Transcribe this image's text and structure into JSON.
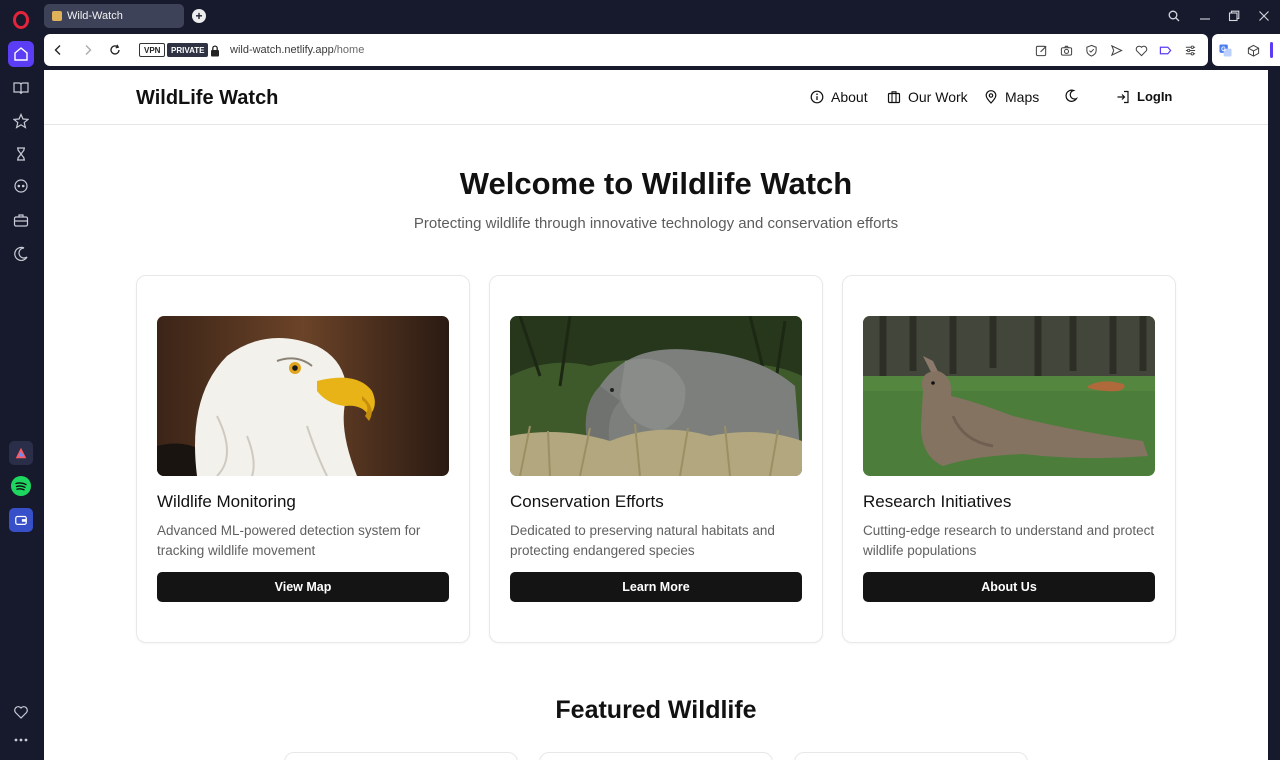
{
  "browser": {
    "tab_title": "Wild-Watch",
    "new_tab": "+",
    "badges": {
      "vpn": "VPN",
      "private": "PRIVATE"
    },
    "url_host": "wild-watch.netlify.app",
    "url_path": "/home",
    "accent": "#5b3df5"
  },
  "sidebar": {
    "items": [
      "home-icon",
      "book-icon",
      "star-icon",
      "hourglass-icon",
      "skull-icon",
      "briefcase-icon",
      "moon-icon"
    ],
    "apps": [
      "aria-app-icon",
      "spotify-app-icon",
      "wallet-app-icon"
    ],
    "bottom": [
      "heart-icon",
      "more-icon"
    ]
  },
  "site": {
    "logo": "WildLife Watch",
    "nav": {
      "about": "About",
      "work": "Our Work",
      "maps": "Maps",
      "login": "LogIn"
    },
    "hero": {
      "title": "Welcome to Wildlife Watch",
      "subtitle": "Protecting wildlife through innovative technology and conservation efforts"
    },
    "cards": [
      {
        "title": "Wildlife Monitoring",
        "text": "Advanced ML-powered detection system for tracking wildlife movement",
        "button": "View Map",
        "image": "bald-eagle"
      },
      {
        "title": "Conservation Efforts",
        "text": "Dedicated to preserving natural habitats and protecting endangered species",
        "button": "Learn More",
        "image": "elephant"
      },
      {
        "title": "Research Initiatives",
        "text": "Cutting-edge research to understand and protect wildlife populations",
        "button": "About Us",
        "image": "kangaroo"
      }
    ],
    "featured_title": "Featured Wildlife"
  }
}
